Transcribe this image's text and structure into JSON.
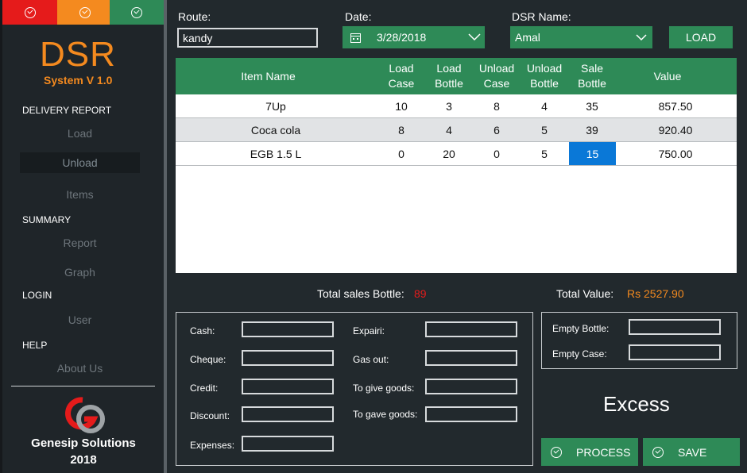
{
  "topbar": {
    "colors": [
      "#e51b1b",
      "#f48a1f",
      "#2e8a57"
    ],
    "icon": "check-circle-icon"
  },
  "logo": {
    "title": "DSR",
    "subtitle": "System V 1.0"
  },
  "sidebar": {
    "sections": [
      {
        "title": "DELIVERY REPORT",
        "items": [
          "Load",
          "Unload",
          "Items"
        ]
      },
      {
        "title": "SUMMARY",
        "items": [
          "Report",
          "Graph"
        ]
      },
      {
        "title": "LOGIN",
        "items": [
          "User"
        ]
      },
      {
        "title": "HELP",
        "items": [
          "About Us"
        ]
      }
    ],
    "active_item": "Unload",
    "company": "Genesip Solutions",
    "year": "2018"
  },
  "filters": {
    "route_label": "Route:",
    "route_value": "kandy",
    "date_label": "Date:",
    "date_value": "3/28/2018",
    "dsr_label": "DSR Name:",
    "dsr_value": "Amal",
    "load_button": "LOAD"
  },
  "grid": {
    "columns": [
      "Item Name",
      "Load Case",
      "Load Bottle",
      "Unload Case",
      "Unload Bottle",
      "Sale Bottle",
      "Value"
    ],
    "rows": [
      [
        "7Up",
        "10",
        "3",
        "8",
        "4",
        "35",
        "857.50"
      ],
      [
        "Coca cola",
        "8",
        "4",
        "6",
        "5",
        "39",
        "920.40"
      ],
      [
        "EGB 1.5 L",
        "0",
        "20",
        "0",
        "5",
        "15",
        "750.00"
      ]
    ]
  },
  "totals": {
    "sales_label": "Total sales Bottle:",
    "sales_value": "89",
    "value_label": "Total Value:",
    "value_value": "Rs 2527.90"
  },
  "payments": {
    "left": [
      "Cash:",
      "Cheque:",
      "Credit:",
      "Discount:",
      "Expenses:"
    ],
    "right": [
      "Expairi:",
      "Gas out:",
      "To give goods:",
      "To gave goods:"
    ]
  },
  "empties": {
    "bottle_label": "Empty Bottle:",
    "case_label": "Empty Case:"
  },
  "excess_label": "Excess",
  "actions": {
    "process": "PROCESS",
    "save": "SAVE"
  }
}
